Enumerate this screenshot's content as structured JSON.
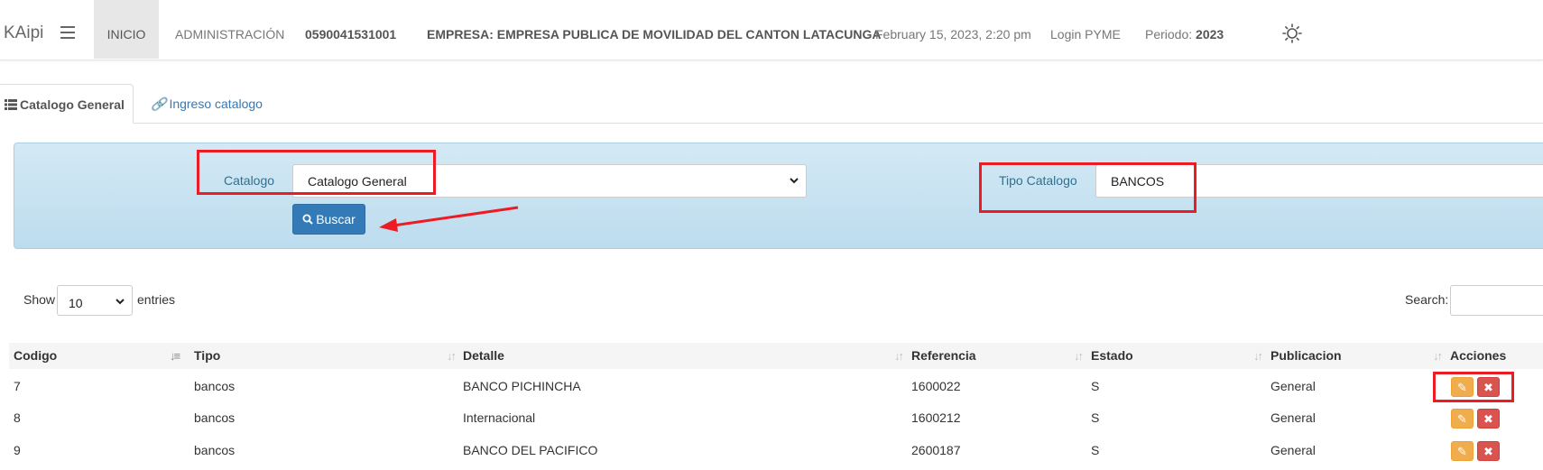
{
  "navbar": {
    "brand": "KAipi",
    "items": {
      "inicio": "INICIO",
      "administracion": "ADMINISTRACIÓN",
      "ruc": "0590041531001",
      "empresa": "EMPRESA: EMPRESA PUBLICA DE MOVILIDAD DEL CANTON LATACUNGA",
      "date": "February 15, 2023, 2:20 pm",
      "login": "Login PYME",
      "periodo_label": "Periodo:",
      "periodo_value": "2023"
    },
    "icons": [
      "menu-icon",
      "sun-icon"
    ]
  },
  "tabs": [
    {
      "label": "Catalogo General",
      "icon": "list-icon",
      "active": true
    },
    {
      "label": "Ingreso catalogo",
      "icon": "link-icon",
      "active": false
    }
  ],
  "filter": {
    "catalogo_label": "Catalogo",
    "catalogo_value": "Catalogo General",
    "tipo_label": "Tipo Catalogo",
    "tipo_value": "BANCOS",
    "buscar_label": "Buscar"
  },
  "table_controls": {
    "show_label": "Show",
    "entries_value": "10",
    "entries_label": "entries",
    "search_label": "Search:"
  },
  "table": {
    "columns": [
      "Codigo",
      "Tipo",
      "Detalle",
      "Referencia",
      "Estado",
      "Publicacion",
      "Acciones"
    ],
    "rows": [
      {
        "codigo": "7",
        "tipo": "bancos",
        "detalle": "BANCO PICHINCHA",
        "referencia": "1600022",
        "estado": "S",
        "publicacion": "General"
      },
      {
        "codigo": "8",
        "tipo": "bancos",
        "detalle": "Internacional",
        "referencia": "1600212",
        "estado": "S",
        "publicacion": "General"
      },
      {
        "codigo": "9",
        "tipo": "bancos",
        "detalle": "BANCO DEL PACIFICO",
        "referencia": "2600187",
        "estado": "S",
        "publicacion": "General"
      }
    ],
    "action_icons": [
      "edit-icon",
      "delete-icon"
    ]
  },
  "colors": {
    "annotation_red": "#ec1c24",
    "primary": "#337ab7",
    "edit": "#f0ad4e",
    "delete": "#d9534f",
    "panel": "#c6e2f1"
  }
}
